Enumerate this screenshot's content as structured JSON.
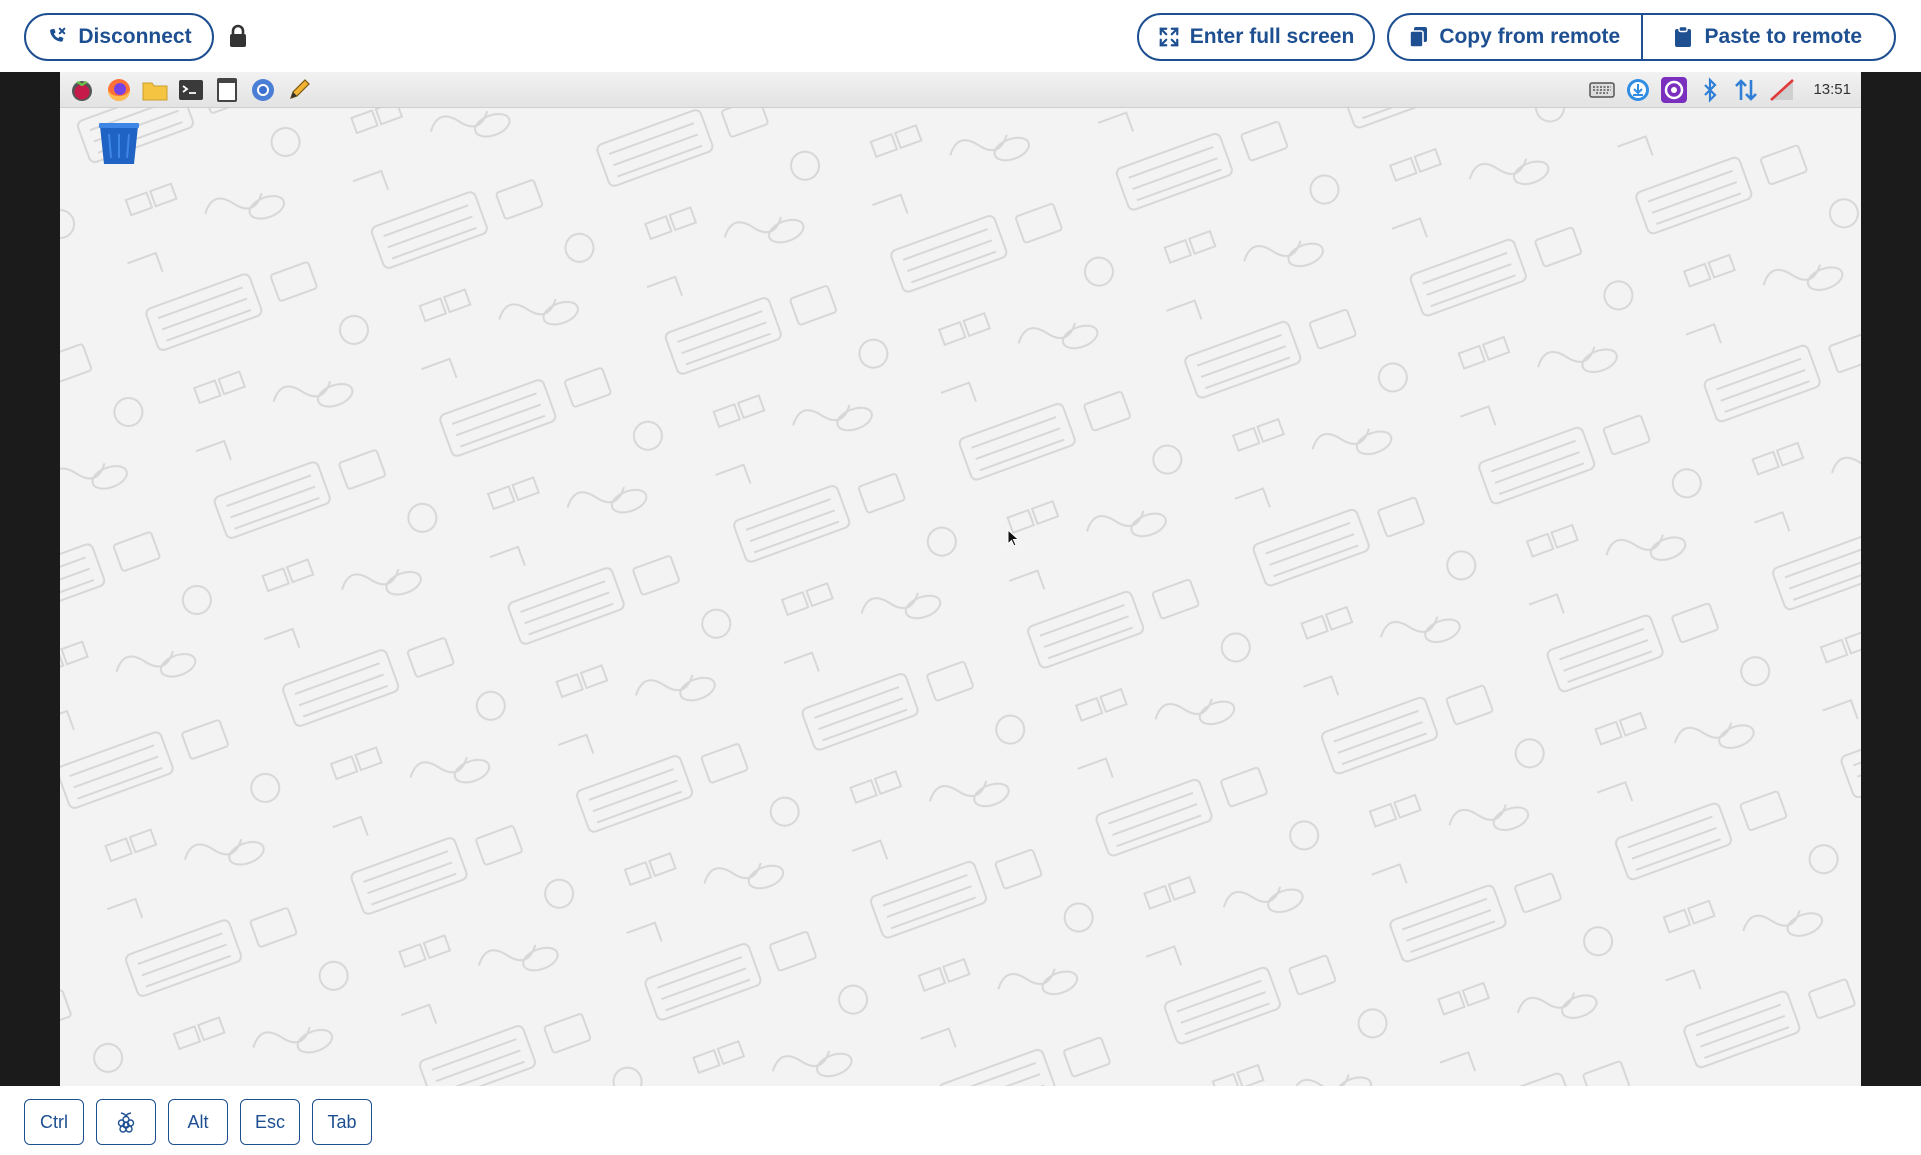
{
  "toolbar": {
    "disconnect_label": "Disconnect",
    "fullscreen_label": "Enter full screen",
    "copy_label": "Copy from remote",
    "paste_label": "Paste to remote"
  },
  "taskbar": {
    "clock": "13:51",
    "launchers": [
      "raspberry-menu-icon",
      "firefox-icon",
      "file-manager-icon",
      "terminal-icon",
      "document-icon",
      "chromium-icon",
      "pencil-icon"
    ],
    "tray": [
      "keyboard-icon",
      "download-icon",
      "vnc-icon",
      "bluetooth-icon",
      "network-icon",
      "volume-muted-icon"
    ]
  },
  "keys": {
    "ctrl": "Ctrl",
    "alt": "Alt",
    "esc": "Esc",
    "tab": "Tab"
  },
  "colors": {
    "accent": "#1d4f91",
    "wallpaper": "#f3f3f3",
    "frame": "#1b1b1b"
  }
}
